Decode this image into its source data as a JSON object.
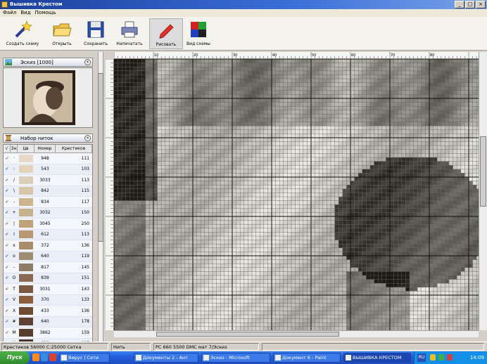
{
  "window": {
    "title": "Вышивка Крестом",
    "controls": [
      "_",
      "□",
      "×"
    ]
  },
  "menu": [
    "Файл",
    "Вид",
    "Помощь"
  ],
  "toolbar": [
    {
      "label": "Создать схему",
      "icon": "wand-icon"
    },
    {
      "label": "Открыть",
      "icon": "folder-icon"
    },
    {
      "label": "Сохранить",
      "icon": "floppy-icon"
    },
    {
      "label": "Напечатать",
      "icon": "printer-icon"
    },
    {
      "label": "Рисовать",
      "icon": "pencil-icon",
      "active": true
    },
    {
      "label": "Вид схемы",
      "icon": "color-grid-icon"
    }
  ],
  "preview_panel": {
    "title": "Эскиз [1000]",
    "close": "×"
  },
  "palette_panel": {
    "title": "Набор ниток",
    "close": "×",
    "headers": [
      "√",
      "Зн",
      "Цв",
      "Номер",
      "Крестиков"
    ],
    "rows": [
      {
        "sym": "·",
        "color": "#e8d8c8",
        "code": "948",
        "count": "111"
      },
      {
        "sym": ":",
        "color": "#e6d2b8",
        "code": "543",
        "count": "103"
      },
      {
        "sym": "/",
        "color": "#dccfb9",
        "code": "3033",
        "count": "113"
      },
      {
        "sym": "\\",
        "color": "#d8c6a8",
        "code": "842",
        "count": "115"
      },
      {
        "sym": "-",
        "color": "#cbb48e",
        "code": "834",
        "count": "117"
      },
      {
        "sym": "+",
        "color": "#c8b28e",
        "code": "3032",
        "count": "150"
      },
      {
        "sym": "|",
        "color": "#bfa37c",
        "code": "3045",
        "count": "250"
      },
      {
        "sym": "I",
        "color": "#b89870",
        "code": "612",
        "count": "113"
      },
      {
        "sym": "x",
        "color": "#a88d6c",
        "code": "372",
        "count": "136"
      },
      {
        "sym": "o",
        "color": "#9d8e72",
        "code": "640",
        "count": "119"
      },
      {
        "sym": "-",
        "color": "#8f7c66",
        "code": "817",
        "count": "145"
      },
      {
        "sym": "O",
        "color": "#8a6a52",
        "code": "839",
        "count": "151"
      },
      {
        "sym": "T",
        "color": "#7a5a42",
        "code": "3031",
        "count": "143"
      },
      {
        "sym": "V",
        "color": "#8c5f3c",
        "code": "370",
        "count": "133"
      },
      {
        "sym": "X",
        "color": "#6e4c34",
        "code": "433",
        "count": "136"
      },
      {
        "sym": "#",
        "color": "#5f4232",
        "code": "640",
        "count": "178"
      },
      {
        "sym": "M",
        "color": "#5a3e2e",
        "code": "3862",
        "count": "159"
      },
      {
        "sym": "N",
        "color": "#4a3428",
        "code": "838",
        "count": "115"
      },
      {
        "sym": "W",
        "color": "#3a2a22",
        "code": "3371",
        "count": "153"
      }
    ]
  },
  "ruler_numbers": [
    "10",
    "20",
    "30",
    "40",
    "50",
    "60",
    "70",
    "80"
  ],
  "status": {
    "cell1": "Крестиков 56000 С:25000 Сетка",
    "cell2": "Нить",
    "cell3": "PC 660 5500 DMC мат 7/Эскиз"
  },
  "taskbar": {
    "start": "Пуск",
    "tasks": [
      {
        "label": "Вирус | Сети",
        "active": false
      },
      {
        "label": "Документы 2 - Ант",
        "active": false
      },
      {
        "label": "Эскиз - Microsoft",
        "active": false
      },
      {
        "label": "Документ 6 - Paint",
        "active": false
      },
      {
        "label": "ВЫШИВКА КРЕСТОМ",
        "active": true
      }
    ],
    "lang": "RU",
    "clock": "14:09"
  }
}
